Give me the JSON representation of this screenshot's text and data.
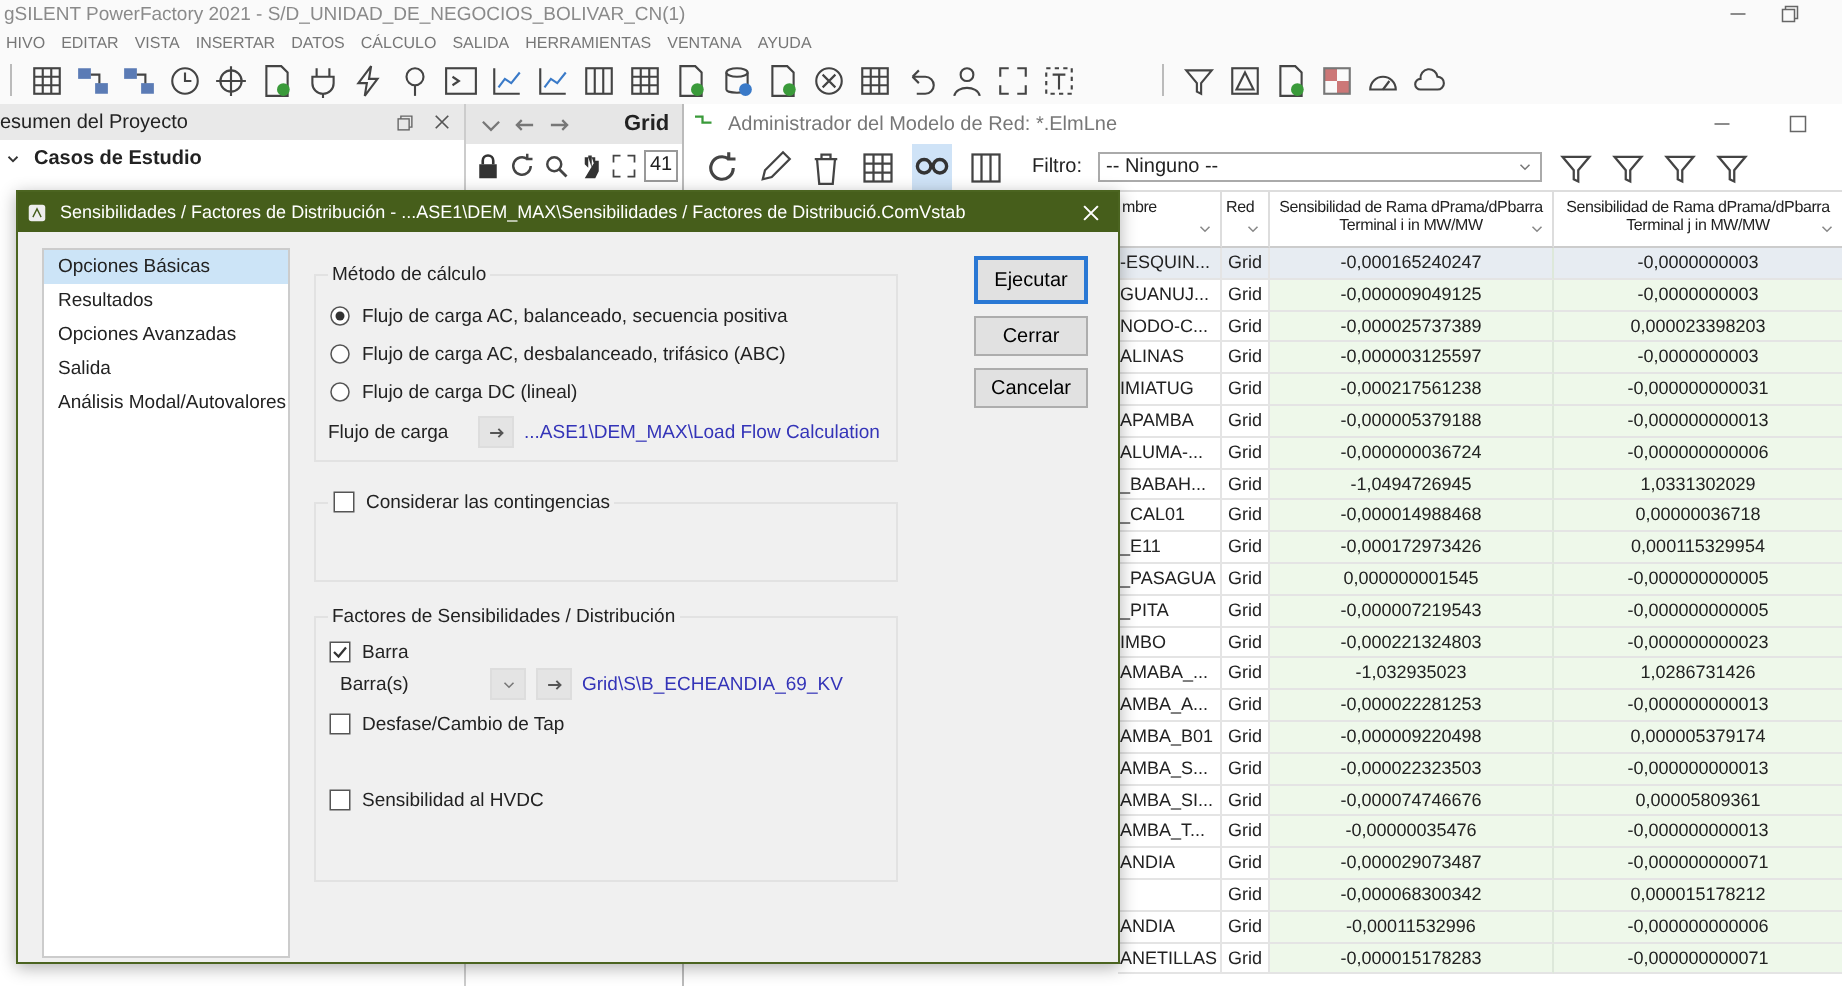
{
  "app": {
    "title": "gSILENT PowerFactory 2021 - S/D_UNIDAD_DE_NEGOCIOS_BOLIVAR_CN(1)",
    "menu": [
      "HIVO",
      "EDITAR",
      "VISTA",
      "INSERTAR",
      "DATOS",
      "CÁLCULO",
      "SALIDA",
      "HERRAMIENTAS",
      "VENTANA",
      "AYUDA"
    ]
  },
  "project_panel": {
    "title": "esumen del Proyecto",
    "tree": [
      {
        "label": "Casos de Estudio",
        "expanded": true
      }
    ]
  },
  "grid_panel": {
    "title": "Grid",
    "zoom_value": "41"
  },
  "manager": {
    "title": "Administrador del Modelo de Red: *.ElmLne",
    "filter_label": "Filtro:",
    "filter_value": "-- Ninguno --",
    "columns": [
      {
        "label": "mbre"
      },
      {
        "label": "Red"
      },
      {
        "label": "Sensibilidad de Rama dPrama/dPbarra",
        "unit": "Terminal i in MW/MW"
      },
      {
        "label": "Sensibilidad de Rama dPrama/dPbarra",
        "unit": "Terminal j in MW/MW"
      }
    ],
    "rows": [
      {
        "selected": true,
        "cells": [
          "-ESQUIN...",
          "Grid",
          "-0,000165240247",
          "-0,0000000003"
        ]
      },
      {
        "selected": false,
        "cells": [
          "GUANUJ...",
          "Grid",
          "-0,000009049125",
          "-0,0000000003"
        ]
      },
      {
        "selected": false,
        "cells": [
          "NODO-C...",
          "Grid",
          "-0,000025737389",
          "0,000023398203"
        ]
      },
      {
        "selected": false,
        "cells": [
          "ALINAS",
          "Grid",
          "-0,000003125597",
          "-0,0000000003"
        ]
      },
      {
        "selected": false,
        "cells": [
          "IMIATUG",
          "Grid",
          "-0,000217561238",
          "-0,000000000031"
        ]
      },
      {
        "selected": false,
        "cells": [
          "APAMBA",
          "Grid",
          "-0,000005379188",
          "-0,000000000013"
        ]
      },
      {
        "selected": false,
        "cells": [
          "ALUMA-...",
          "Grid",
          "-0,000000036724",
          "-0,000000000006"
        ]
      },
      {
        "selected": false,
        "cells": [
          "_BABAH...",
          "Grid",
          "-1,0494726945",
          "1,0331302029"
        ]
      },
      {
        "selected": false,
        "cells": [
          "_CAL01",
          "Grid",
          "-0,000014988468",
          "0,00000036718"
        ]
      },
      {
        "selected": false,
        "cells": [
          "_E11",
          "Grid",
          "-0,000172973426",
          "0,000115329954"
        ]
      },
      {
        "selected": false,
        "cells": [
          "_PASAGUA",
          "Grid",
          "0,000000001545",
          "-0,000000000005"
        ]
      },
      {
        "selected": false,
        "cells": [
          "_PITA",
          "Grid",
          "-0,000007219543",
          "-0,000000000005"
        ]
      },
      {
        "selected": false,
        "cells": [
          "IMBO",
          "Grid",
          "-0,000221324803",
          "-0,000000000023"
        ]
      },
      {
        "selected": false,
        "cells": [
          "AMABA_...",
          "Grid",
          "-1,032935023",
          "1,0286731426"
        ]
      },
      {
        "selected": false,
        "cells": [
          "AMBA_A...",
          "Grid",
          "-0,000022281253",
          "-0,000000000013"
        ]
      },
      {
        "selected": false,
        "cells": [
          "AMBA_B01",
          "Grid",
          "-0,000009220498",
          "0,000005379174"
        ]
      },
      {
        "selected": false,
        "cells": [
          "AMBA_S...",
          "Grid",
          "-0,000022323503",
          "-0,000000000013"
        ]
      },
      {
        "selected": false,
        "cells": [
          "AMBA_SI...",
          "Grid",
          "-0,000074746676",
          "0,00005809361"
        ]
      },
      {
        "selected": false,
        "cells": [
          "AMBA_T...",
          "Grid",
          "-0,00000035476",
          "-0,000000000013"
        ]
      },
      {
        "selected": false,
        "cells": [
          "ANDIA",
          "Grid",
          "-0,000029073487",
          "-0,000000000071"
        ]
      },
      {
        "selected": false,
        "cells": [
          null,
          "Grid",
          "-0,000068300342",
          "0,000015178212"
        ]
      },
      {
        "selected": false,
        "cells": [
          "ANDIA",
          "Grid",
          "-0,00011532996",
          "-0,000000000006"
        ]
      },
      {
        "selected": false,
        "cells": [
          "ANETILLAS",
          "Grid",
          "-0,000015178283",
          "-0,000000000071"
        ]
      }
    ]
  },
  "dialog": {
    "title": "Sensibilidades / Factores de Distribución - ...ASE1\\DEM_MAX\\Sensibilidades / Factores de Distribució.ComVstab",
    "nav": [
      {
        "label": "Opciones Básicas",
        "selected": true
      },
      {
        "label": "Resultados",
        "selected": false
      },
      {
        "label": "Opciones Avanzadas",
        "selected": false
      },
      {
        "label": "Salida",
        "selected": false
      },
      {
        "label": "Análisis Modal/Autovalores",
        "selected": false
      }
    ],
    "method": {
      "title": "Método de cálculo",
      "options": [
        {
          "label": "Flujo de carga AC, balanceado, secuencia positiva",
          "selected": true
        },
        {
          "label": "Flujo de carga AC, desbalanceado, trifásico (ABC)",
          "selected": false
        },
        {
          "label": "Flujo de carga DC (lineal)",
          "selected": false
        }
      ],
      "load_flow_label": "Flujo de carga",
      "load_flow_link": "...ASE1\\DEM_MAX\\Load Flow Calculation"
    },
    "contingencies": {
      "label": "Considerar las contingencias",
      "checked": false
    },
    "factors": {
      "title": "Factores de Sensibilidades / Distribución",
      "items": [
        {
          "kind": "checkbox",
          "label": "Barra",
          "checked": true
        },
        {
          "kind": "selector",
          "label": "Barra(s)",
          "link": "Grid\\S\\B_ECHEANDIA_69_KV"
        },
        {
          "kind": "checkbox",
          "label": "Desfase/Cambio de Tap",
          "checked": false
        },
        {
          "kind": "checkbox",
          "label": "Sensibilidad al HVDC",
          "checked": false
        }
      ]
    },
    "buttons": [
      {
        "label": "Ejecutar",
        "default": true
      },
      {
        "label": "Cerrar",
        "default": false
      },
      {
        "label": "Cancelar",
        "default": false
      }
    ]
  }
}
